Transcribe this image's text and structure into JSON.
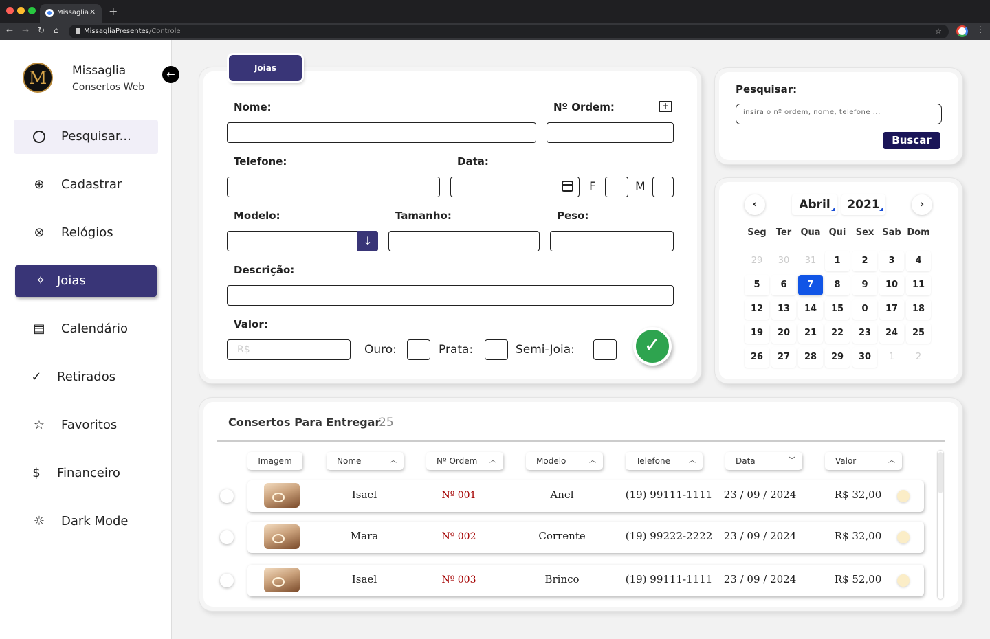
{
  "browser": {
    "tab_title": "Missaglia",
    "url_domain": "MissagliaPresentes",
    "url_path": "/Controle"
  },
  "sidebar": {
    "logo_letter": "M",
    "brand": "Missaglia",
    "subtitle": "Consertos Web",
    "items": [
      {
        "label": "Pesquisar...",
        "icon": "search-icon"
      },
      {
        "label": "Cadastrar",
        "icon": "plus-circle-icon"
      },
      {
        "label": "Relógios",
        "icon": "watch-icon"
      },
      {
        "label": "Joias",
        "icon": "sparkles-icon"
      },
      {
        "label": "Calendário",
        "icon": "calendar-icon"
      },
      {
        "label": "Retirados",
        "icon": "check-circle-icon"
      },
      {
        "label": "Favoritos",
        "icon": "star-icon"
      },
      {
        "label": "Financeiro",
        "icon": "dollar-circle-icon"
      },
      {
        "label": "Dark Mode",
        "icon": "sun-icon"
      }
    ],
    "active_item": "Joias"
  },
  "form": {
    "tab_label": "Joias",
    "nome_label": "Nome:",
    "ordem_label": "Nº Ordem:",
    "telefone_label": "Telefone:",
    "data_label": "Data:",
    "f_label": "F",
    "m_label": "M",
    "modelo_label": "Modelo:",
    "tamanho_label": "Tamanho:",
    "peso_label": "Peso:",
    "descricao_label": "Descrição:",
    "valor_label": "Valor:",
    "valor_placeholder": "R$",
    "ouro_label": "Ouro:",
    "prata_label": "Prata:",
    "semijoia_label": "Semi-Joia:"
  },
  "search": {
    "label": "Pesquisar:",
    "placeholder": "insira o nº ordem, nome, telefone ...",
    "button": "Buscar"
  },
  "calendar": {
    "month": "Abril",
    "year": "2021",
    "weekdays": [
      "Seg",
      "Ter",
      "Qua",
      "Qui",
      "Sex",
      "Sab",
      "Dom"
    ],
    "weeks": [
      [
        "29",
        "30",
        "31",
        "1",
        "2",
        "3",
        "4"
      ],
      [
        "5",
        "6",
        "7",
        "8",
        "9",
        "10",
        "11"
      ],
      [
        "12",
        "13",
        "14",
        "15",
        "0",
        "17",
        "18"
      ],
      [
        "19",
        "20",
        "21",
        "22",
        "23",
        "24",
        "25"
      ],
      [
        "26",
        "27",
        "28",
        "29",
        "30",
        "1",
        "2"
      ]
    ],
    "today": "7",
    "accent_color": "#1155e6"
  },
  "table": {
    "title": "Consertos Para Entregar",
    "count": "25",
    "headers": [
      "Imagem",
      "Nome",
      "Nº Ordem",
      "Modelo",
      "Telefone",
      "Data",
      "Valor"
    ],
    "rows": [
      {
        "nome": "Isael",
        "ordem": "Nº 001",
        "modelo": "Anel",
        "telefone": "(19) 99111-1111",
        "data": "23 / 09 / 2024",
        "valor": "R$ 32,00"
      },
      {
        "nome": "Mara",
        "ordem": "Nº 002",
        "modelo": "Corrente",
        "telefone": "(19) 99222-2222",
        "data": "23 / 09 / 2024",
        "valor": "R$ 32,00"
      },
      {
        "nome": "Isael",
        "ordem": "Nº 003",
        "modelo": "Brinco",
        "telefone": "(19) 99111-1111",
        "data": "23 / 09 / 2024",
        "valor": "R$ 52,00"
      }
    ]
  },
  "colors": {
    "primary": "#393577",
    "button_dark": "#1a1558",
    "confirm": "#2ea44f",
    "order_red": "#a40000"
  }
}
